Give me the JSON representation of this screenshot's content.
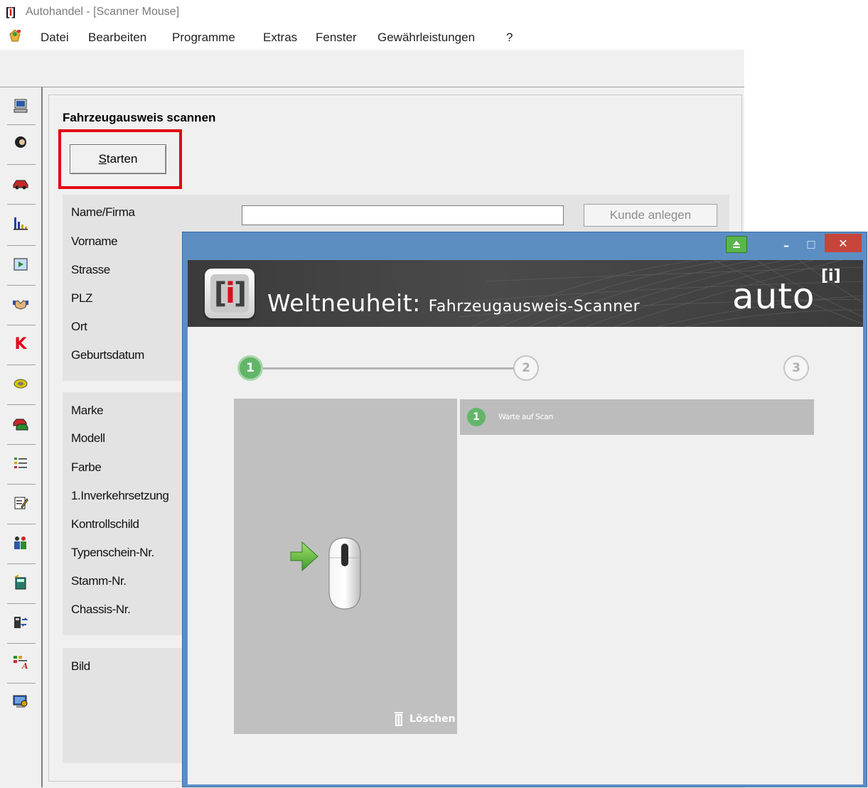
{
  "window": {
    "logo": "[i]",
    "title": "Autohandel - [Scanner Mouse]"
  },
  "menu": {
    "items": [
      "Datei",
      "Bearbeiten",
      "Programme",
      "Extras",
      "Fenster",
      "Gewährleistungen",
      "?"
    ]
  },
  "sidebar": {
    "icons": [
      "computer-icon",
      "person-icon",
      "car-icon",
      "bar-chart-icon",
      "film-icon",
      "handshake-icon",
      "k-letter-icon",
      "coin-icon",
      "cars-icon",
      "list-icon",
      "notepad-icon",
      "people-icon",
      "calculator-icon",
      "exchange-icon",
      "report-icon",
      "monitor-icon"
    ]
  },
  "form": {
    "section_title": "Fahrzeugausweis scannen",
    "start_button": "Starten",
    "kunde_button": "Kunde anlegen",
    "name_value": "",
    "person_labels": [
      "Name/Firma",
      "Vorname",
      "Strasse",
      "PLZ",
      "Ort",
      "Geburtsdatum"
    ],
    "vehicle_labels": [
      "Marke",
      "Modell",
      "Farbe",
      "1.Inverkehrsetzung",
      "Kontrollschild",
      "Typenschein-Nr.",
      "Stamm-Nr.",
      "Chassis-Nr."
    ],
    "image_label": "Bild"
  },
  "popup": {
    "controls": {
      "minimize": "–",
      "maximize": "□",
      "close": "✕"
    },
    "banner_logo_left": "[",
    "banner_logo_i": "i",
    "banner_logo_right": "]",
    "banner_title": "Weltneuheit:",
    "banner_subtitle": "Fahrzeugausweis-Scanner",
    "brand": "auto",
    "brand_superscript": "[i]",
    "steps": [
      "1",
      "2",
      "3"
    ],
    "delete_label": "Löschen",
    "status_number": "1",
    "status_text": "Warte auf Scan"
  },
  "colors": {
    "highlight": "#e30613",
    "popup_frame": "#5c8ec4",
    "step_active": "#63b56a",
    "close_button": "#c7453a"
  }
}
